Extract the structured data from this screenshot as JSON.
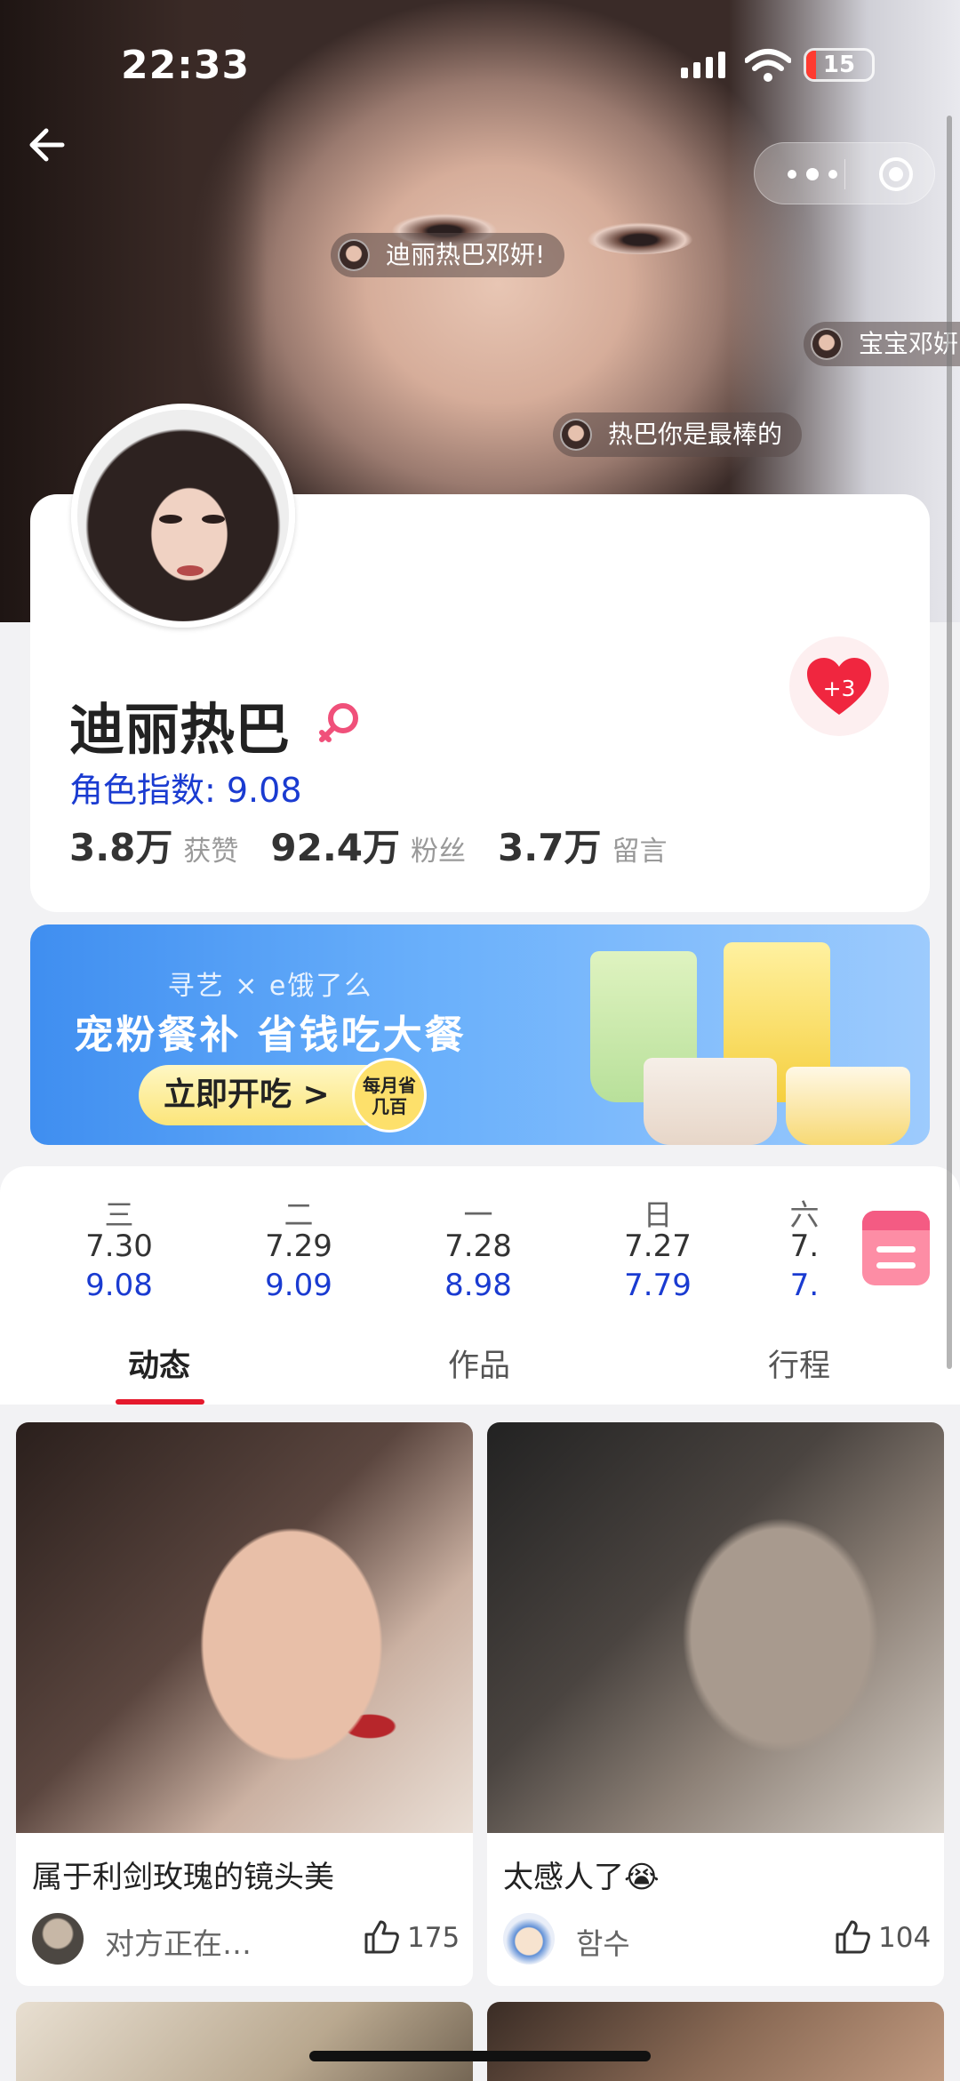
{
  "status_bar": {
    "time": "22:33",
    "battery": "15"
  },
  "danmaku": [
    {
      "text": "迪丽热巴邓妍!"
    },
    {
      "text": "宝宝邓妍"
    },
    {
      "text": "热巴你是最棒的"
    }
  ],
  "profile": {
    "name": "迪丽热巴",
    "likes_badge": "+3",
    "index_label": "角色指数: 9.08",
    "stats": [
      {
        "value": "3.8万",
        "unit": "获赞"
      },
      {
        "value": "92.4万",
        "unit": "粉丝"
      },
      {
        "value": "3.7万",
        "unit": "留言"
      }
    ]
  },
  "banner": {
    "brands": "寻艺 × e饿了么",
    "headline": "宠粉餐补 省钱吃大餐",
    "button": "立即开吃 >",
    "badge": "每月省几百"
  },
  "calendar": [
    {
      "weekday": "三",
      "date": "7.30",
      "score": "9.08"
    },
    {
      "weekday": "二",
      "date": "7.29",
      "score": "9.09"
    },
    {
      "weekday": "一",
      "date": "7.28",
      "score": "8.98"
    },
    {
      "weekday": "日",
      "date": "7.27",
      "score": "7.79"
    },
    {
      "weekday": "六",
      "date": "7.",
      "score": "7."
    }
  ],
  "tabs": [
    "动态",
    "作品",
    "行程"
  ],
  "posts": [
    {
      "caption": "属于利剑玫瑰的镜头美",
      "user": "对方正在…",
      "likes": "175"
    },
    {
      "caption": "太感人了😭",
      "user": "함수",
      "likes": "104"
    }
  ],
  "colors": {
    "accent_blue": "#1a3bd1",
    "accent_red": "#e5192c",
    "calendar_pink": "#fd8da5"
  }
}
